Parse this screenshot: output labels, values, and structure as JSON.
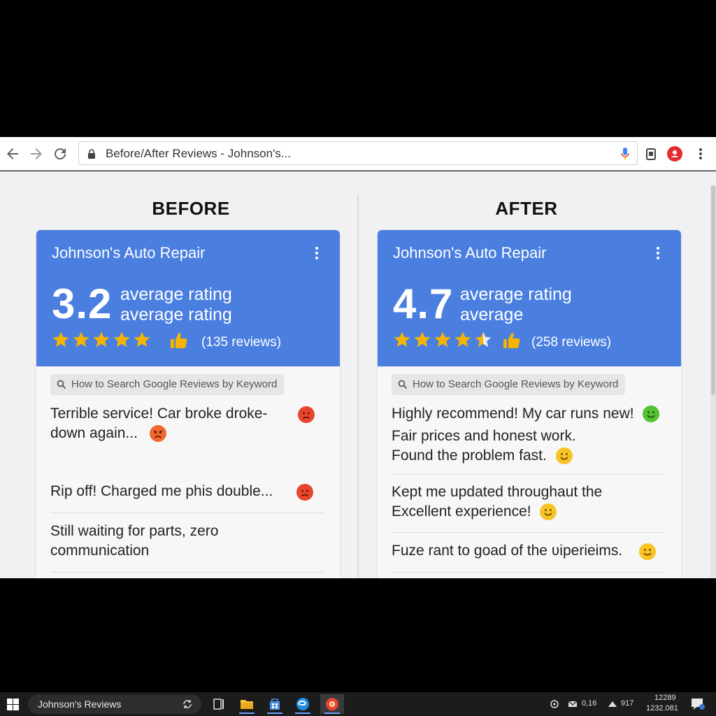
{
  "browser": {
    "tab_title": "Before/After Reviews - Johnson's...",
    "back_icon": "arrow-left-icon",
    "forward_icon": "arrow-right-icon",
    "reload_icon": "reload-icon"
  },
  "before": {
    "heading": "BEFORE",
    "business_name": "Johnson's Auto Repair",
    "rating": "3.2",
    "rating_line1": "average rating",
    "rating_line2": "average rating",
    "stars_filled": 5,
    "review_count": "(135 reviews)",
    "search_chip": "How to Search Google Reviews by Keyword",
    "reviews": [
      {
        "line1": "Terrible service! Car broke droke-",
        "line2": "down again..."
      },
      {
        "line1": "Rip off! Charged me phis double..."
      },
      {
        "line1": "Still waiting for parts, zero",
        "line2": "communication"
      }
    ]
  },
  "after": {
    "heading": "AFTER",
    "business_name": "Johnson's Auto Repair",
    "rating": "4.7",
    "rating_line1": "average rating",
    "rating_line2": "average",
    "stars_filled": 4.5,
    "review_count": "(258 reviews)",
    "search_chip": "How to Search Google Reviews by Keyword",
    "reviews": [
      {
        "line1": "Highly recommend! My car runs new!",
        "line2": "Fair prices and honest work.",
        "line3": "Found the problem fast."
      },
      {
        "line1": "Kept me updated throughaut the",
        "line2": "Excellent experience!"
      },
      {
        "line1": "Fuze rant to goad of the ʋiperieims."
      }
    ]
  },
  "colors": {
    "card_header": "#4a7fe0",
    "star": "#f6b400",
    "angry_red": "#e8452c",
    "angry_orange": "#ef6a2c",
    "happy_green": "#52c234",
    "smile_yellow": "#f7c325"
  },
  "taskbar": {
    "search_text": "Johnson's Reviews",
    "tray_net": "0,16",
    "tray_vol": "917",
    "clock_time": "12289",
    "clock_date": "1232.081"
  }
}
